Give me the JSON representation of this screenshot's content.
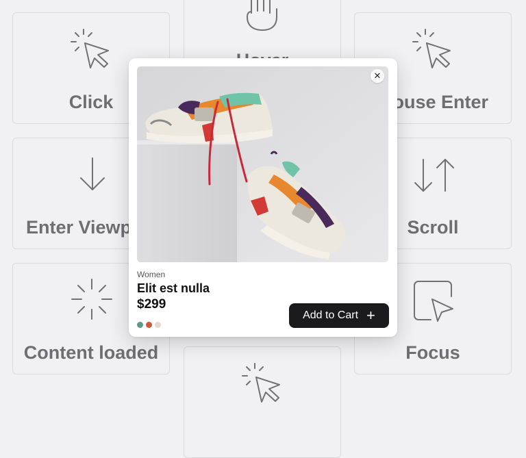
{
  "grid": {
    "click_label": "Click",
    "hover_label": "Hover",
    "mouse_enter_label": "Mouse Enter",
    "enter_viewport_label": "Enter Viewport",
    "scroll_label": "Scroll",
    "content_loaded_label": "Content loaded",
    "focus_label": "Focus"
  },
  "product": {
    "category": "Women",
    "name": "Elit est nulla",
    "price": "$299",
    "close_glyph": "✕",
    "add_to_cart_label": "Add to Cart",
    "add_icon": "+",
    "swatch_colors": [
      "#5a9a8a",
      "#d0553a",
      "#e6d8d0"
    ]
  },
  "icons": {
    "click": "cursor-click-icon",
    "hover": "hand-pointer-icon",
    "mouse_enter": "cursor-click-icon",
    "enter_viewport": "arrow-down-icon",
    "scroll": "scroll-arrows-icon",
    "content_loaded": "loading-spinner-icon",
    "focus": "focus-cursor-icon",
    "close": "close-icon",
    "plus": "plus-icon"
  }
}
